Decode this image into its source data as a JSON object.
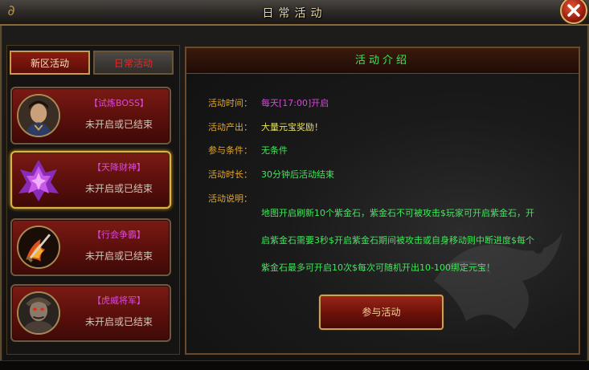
{
  "window": {
    "title": "日常活动"
  },
  "tabs": [
    {
      "label": "新区活动",
      "active": true
    },
    {
      "label": "日常活动",
      "active": false
    }
  ],
  "activities": [
    {
      "name": "【试炼BOSS】",
      "status": "未开启或已结束",
      "icon": "warrior-portrait-icon"
    },
    {
      "name": "【天降财神】",
      "status": "未开启或已结束",
      "icon": "purple-crystal-icon",
      "selected": true
    },
    {
      "name": "【行会争霸】",
      "status": "未开启或已结束",
      "icon": "flame-sword-icon"
    },
    {
      "name": "【虎威将军】",
      "status": "未开启或已结束",
      "icon": "armored-general-icon"
    }
  ],
  "intro": {
    "header": "活动介绍",
    "rows": [
      {
        "label": "活动时间：",
        "value": "每天[17:00]开启"
      },
      {
        "label": "活动产出：",
        "value": "大量元宝奖励！"
      },
      {
        "label": "参与条件：",
        "value": "无条件"
      },
      {
        "label": "活动时长：",
        "value": "30分钟后活动结束"
      }
    ],
    "desc_label": "活动说明：",
    "desc_lines": [
      "地图开启刷新10个紫金石，紫金石不可被攻击$玩家可开启紫金石，开",
      "启紫金石需要3秒$开启紫金石期间被攻击或自身移动则中断进度$每个",
      "紫金石最多可开启10次$每次可随机开出10-100绑定元宝！"
    ],
    "join_label": "参与活动"
  },
  "colors": {
    "label": "#e5a72a",
    "time_value": "#d24ad8",
    "reward_value": "#e8e25a",
    "green_value": "#3fe85a",
    "name_purple": "#d94ad9"
  }
}
